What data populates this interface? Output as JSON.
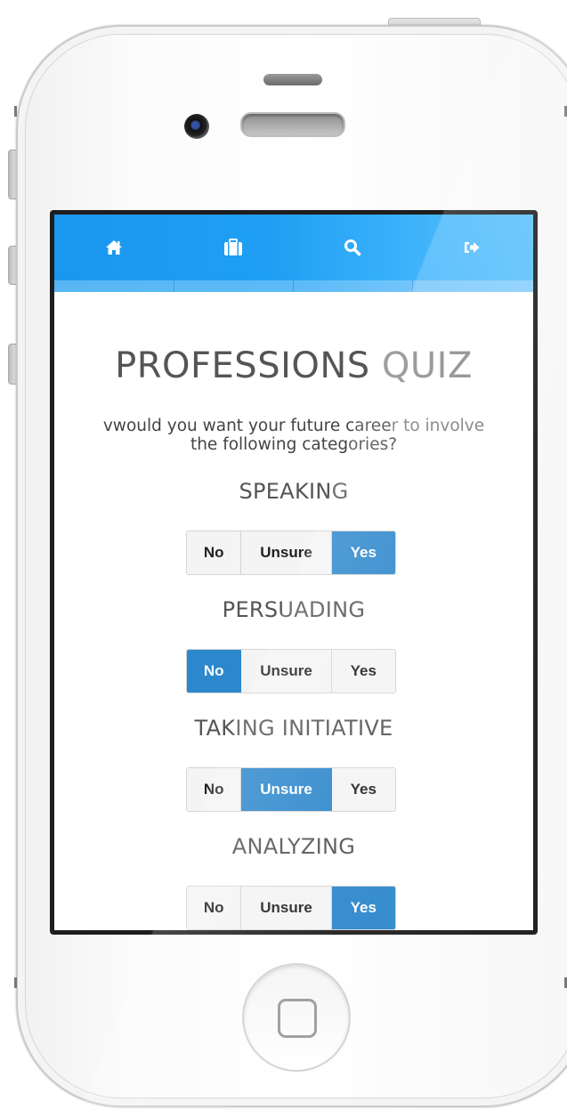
{
  "colors": {
    "nav_blue": "#1f9ff3",
    "accent_active": "#2d87cc",
    "button_bg": "#f4f4f4",
    "title_text": "#555555"
  },
  "nav": {
    "items": [
      {
        "icon": "home-icon"
      },
      {
        "icon": "briefcase-icon"
      },
      {
        "icon": "search-icon"
      },
      {
        "icon": "sign-out-icon"
      }
    ]
  },
  "page": {
    "title_main": "PROFESSIONS",
    "title_light": "QUIZ",
    "intro_line1_main": "vwould you want your future caree",
    "intro_line1_fade": "r to involve",
    "intro_line2": "the following categories?"
  },
  "categories": [
    {
      "label": "SPEAKING",
      "options": [
        "No",
        "Unsure",
        "Yes"
      ],
      "selected": "Yes"
    },
    {
      "label": "PERSUADING",
      "options": [
        "No",
        "Unsure",
        "Yes"
      ],
      "selected": "No"
    },
    {
      "label": "TAKING INITIATIVE",
      "options": [
        "No",
        "Unsure",
        "Yes"
      ],
      "selected": "Unsure"
    },
    {
      "label": "ANALYZING",
      "options": [
        "No",
        "Unsure",
        "Yes"
      ],
      "selected": "Yes"
    }
  ]
}
